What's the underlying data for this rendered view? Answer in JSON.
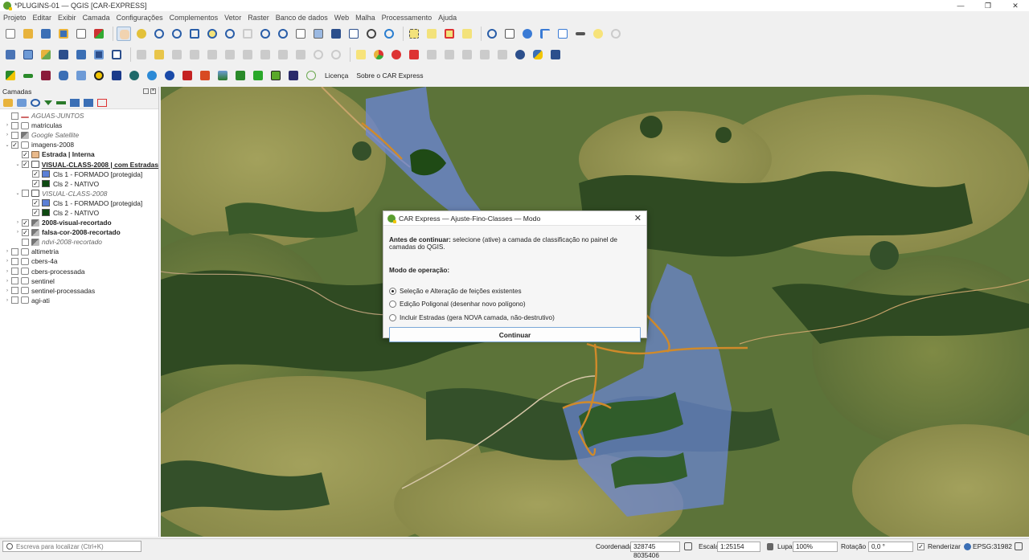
{
  "window": {
    "title": "*PLUGINS-01 — QGIS [CAR-EXPRESS]",
    "controls": [
      "—",
      "❐",
      "✕"
    ]
  },
  "menu": [
    "Projeto",
    "Editar",
    "Exibir",
    "Camada",
    "Configurações",
    "Complementos",
    "Vetor",
    "Raster",
    "Banco de dados",
    "Web",
    "Malha",
    "Processamento",
    "Ajuda"
  ],
  "toolbar3_text": {
    "license": "Licença",
    "about": "Sobre o CAR Express"
  },
  "layers_panel": {
    "title": "Camadas",
    "layers": [
      {
        "label": "AGUAS-JUNTOS",
        "checked": false,
        "style": "it",
        "indent": 0,
        "arrow": "",
        "icon": "line"
      },
      {
        "label": "matriculas",
        "checked": false,
        "style": "",
        "indent": 0,
        "arrow": "›",
        "icon": "group"
      },
      {
        "label": "Google Satellite",
        "checked": false,
        "style": "it",
        "indent": 0,
        "arrow": "›",
        "icon": "raster"
      },
      {
        "label": "imagens-2008",
        "checked": true,
        "style": "",
        "indent": 0,
        "arrow": "⌄",
        "icon": "group"
      },
      {
        "label": "Estrada | Interna",
        "checked": true,
        "style": "bd",
        "indent": 1,
        "arrow": "",
        "icon": "poly-tan"
      },
      {
        "label": "VISUAL-CLASS-2008 | com Estradas",
        "checked": true,
        "style": "bd ul",
        "indent": 1,
        "arrow": "⌄",
        "icon": "poly-outline"
      },
      {
        "label": "Cls 1 - FORMADO [protegida]",
        "checked": true,
        "style": "",
        "indent": 2,
        "arrow": "",
        "swatch": "#5b7fd6"
      },
      {
        "label": "Cls 2 - NATIVO",
        "checked": true,
        "style": "",
        "indent": 2,
        "arrow": "",
        "swatch": "#0e4a12"
      },
      {
        "label": "VISUAL-CLASS-2008",
        "checked": false,
        "style": "it",
        "indent": 1,
        "arrow": "⌄",
        "icon": "poly-outline"
      },
      {
        "label": "Cls 1 - FORMADO [protegida]",
        "checked": true,
        "style": "",
        "indent": 2,
        "arrow": "",
        "swatch": "#5b7fd6"
      },
      {
        "label": "Cls 2 - NATIVO",
        "checked": true,
        "style": "",
        "indent": 2,
        "arrow": "",
        "swatch": "#0e4a12"
      },
      {
        "label": "2008-visual-recortado",
        "checked": true,
        "style": "bd",
        "indent": 1,
        "arrow": "›",
        "icon": "raster"
      },
      {
        "label": "falsa-cor-2008-recortado",
        "checked": true,
        "style": "bd",
        "indent": 1,
        "arrow": "›",
        "icon": "raster"
      },
      {
        "label": "ndvi-2008-recortado",
        "checked": false,
        "style": "it",
        "indent": 1,
        "arrow": "",
        "icon": "raster"
      },
      {
        "label": "altimetria",
        "checked": false,
        "style": "",
        "indent": 0,
        "arrow": "›",
        "icon": "group"
      },
      {
        "label": "cbers-4a",
        "checked": false,
        "style": "",
        "indent": 0,
        "arrow": "›",
        "icon": "group"
      },
      {
        "label": "cbers-processada",
        "checked": false,
        "style": "",
        "indent": 0,
        "arrow": "›",
        "icon": "group"
      },
      {
        "label": "sentinel",
        "checked": false,
        "style": "",
        "indent": 0,
        "arrow": "›",
        "icon": "group"
      },
      {
        "label": "sentinel-processadas",
        "checked": false,
        "style": "",
        "indent": 0,
        "arrow": "›",
        "icon": "group"
      },
      {
        "label": "agi-ati",
        "checked": false,
        "style": "",
        "indent": 0,
        "arrow": "›",
        "icon": "group"
      }
    ]
  },
  "dialog": {
    "title": "CAR Express — Ajuste-Fino-Classes — Modo",
    "close_glyph": "✕",
    "lead_bold": "Antes de continuar:",
    "lead_text": " selecione (ative) a camada de classificação no painel de camadas do QGIS.",
    "mode_label": "Modo de operação:",
    "options": [
      {
        "label": "Seleção e Alteração de feições existentes",
        "selected": true
      },
      {
        "label": "Edição Poligonal (desenhar novo polígono)",
        "selected": false
      },
      {
        "label": "Incluir Estradas (gera NOVA camada, não-destrutivo)",
        "selected": false
      }
    ],
    "continue_label": "Continuar"
  },
  "statusbar": {
    "locator_placeholder": "Escreva para localizar (Ctrl+K)",
    "coord_label": "Coordenada",
    "coord_value": "328745  8035406",
    "scale_label": "Escala",
    "scale_value": "1:25154",
    "magnifier_label": "Lupa",
    "magnifier_value": "100%",
    "rotation_label": "Rotação",
    "rotation_value": "0,0 °",
    "render_label": "Renderizar",
    "crs": "EPSG:31982"
  }
}
